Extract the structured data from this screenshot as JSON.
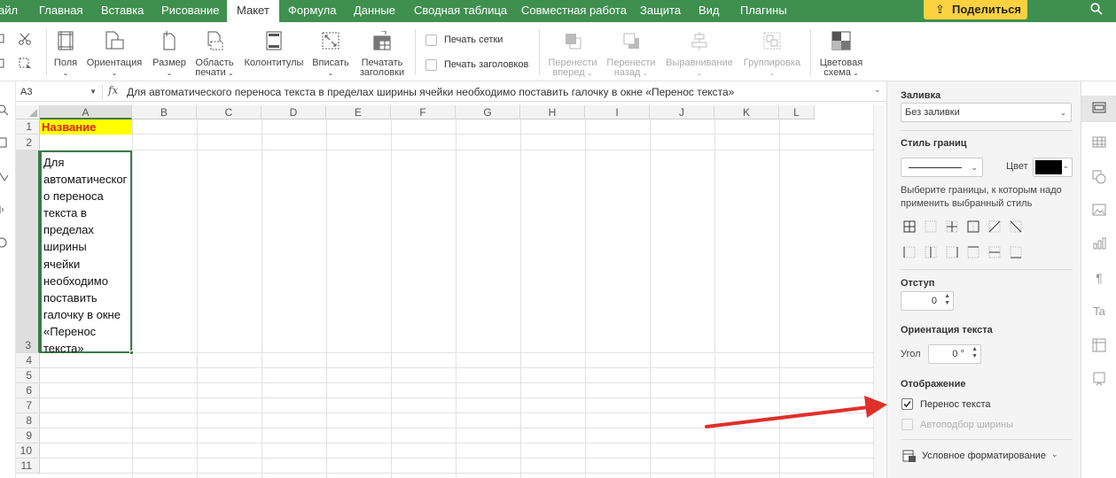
{
  "menu": {
    "items": [
      {
        "label": "айл"
      },
      {
        "label": "Главная"
      },
      {
        "label": "Вставка"
      },
      {
        "label": "Рисование"
      },
      {
        "label": "Макет",
        "active": true
      },
      {
        "label": "Формула"
      },
      {
        "label": "Данные"
      },
      {
        "label": "Сводная таблица"
      },
      {
        "label": "Совместная работа"
      },
      {
        "label": "Защита"
      },
      {
        "label": "Вид"
      },
      {
        "label": "Плагины"
      }
    ],
    "share_label": "Поделиться"
  },
  "ribbon": {
    "fields": "Поля",
    "orientation": "Ориентация",
    "size": "Размер",
    "print_area_1": "Область",
    "print_area_2": "печати",
    "headers_footers": "Колонтитулы",
    "fit": "Вписать",
    "print_titles_1": "Печатать",
    "print_titles_2": "заголовки",
    "print_grid": "Печать сетки",
    "print_headings": "Печать заголовков",
    "bring_forward_1": "Перенести",
    "bring_forward_2": "вперед",
    "send_backward_1": "Перенести",
    "send_backward_2": "назад",
    "align": "Выравнивание",
    "group": "Группировка",
    "color_scheme_1": "Цветовая",
    "color_scheme_2": "схема"
  },
  "formula_bar": {
    "cell_ref": "A3",
    "fx": "fx",
    "content": "Для автоматического переноса текста в пределах ширины ячейки необходимо поставить галочку в окне «Перенос текста»"
  },
  "sheet": {
    "columns": [
      "A",
      "B",
      "C",
      "D",
      "E",
      "F",
      "G",
      "H",
      "I",
      "J",
      "K",
      "L"
    ],
    "rows": [
      "1",
      "2",
      "3",
      "4",
      "5",
      "6",
      "7",
      "8",
      "9",
      "10",
      "11"
    ],
    "cells": {
      "A1": "Название",
      "A3_lines": [
        "Для",
        "автоматическог",
        "о переноса",
        "текста в",
        "пределах",
        "ширины",
        "ячейки",
        "необходимо",
        "поставить",
        "галочку в окне",
        "«Перенос",
        "текста»"
      ]
    },
    "selected_cell": "A3"
  },
  "panel": {
    "fill_label": "Заливка",
    "fill_value": "Без заливки",
    "border_style_label": "Стиль границ",
    "color_label": "Цвет",
    "border_color": "#000000",
    "border_hint": "Выберите границы, к которым надо применить выбранный стиль",
    "indent_label": "Отступ",
    "indent_value": "0",
    "orientation_label": "Ориентация текста",
    "angle_label": "Угол",
    "angle_value": "0 °",
    "display_label": "Отображение",
    "wrap_text_label": "Перенос текста",
    "wrap_text_checked": true,
    "autofit_label": "Автоподбор ширины",
    "autofit_checked": false,
    "cond_format_label": "Условное форматирование"
  },
  "colors": {
    "menubar": "#3f8f4f",
    "share_button": "#fdd13f",
    "selection": "#3b7a4a",
    "highlight_fill": "#ffff00",
    "highlight_text": "#e02020",
    "annotation_arrow": "#e0302a"
  }
}
